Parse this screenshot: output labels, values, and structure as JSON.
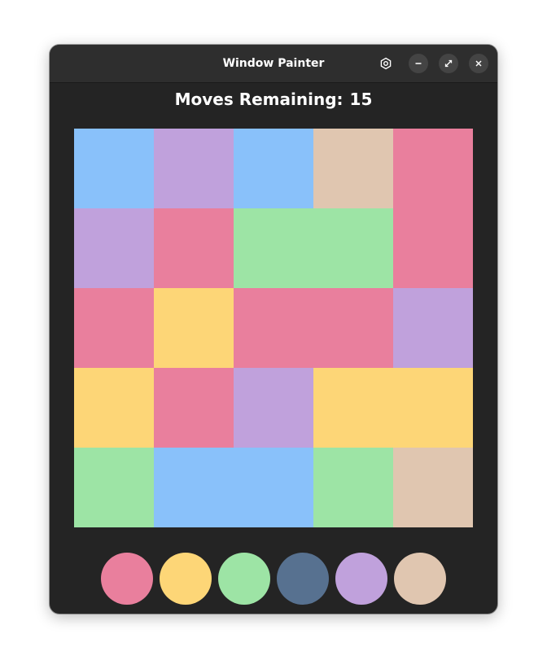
{
  "window": {
    "title": "Window Painter"
  },
  "titlebar": {
    "buttons": [
      {
        "name": "settings-icon"
      },
      {
        "name": "minimize-icon"
      },
      {
        "name": "maximize-icon"
      },
      {
        "name": "close-icon"
      }
    ]
  },
  "status": {
    "moves_label": "Moves Remaining:",
    "moves_value": "15"
  },
  "colors": {
    "window_bg": "#242424",
    "titlebar_bg": "#2e2e2e",
    "pink": "#e97f9d",
    "yellow": "#fdd677",
    "green": "#9de4a5",
    "navy": "#577190",
    "purple": "#c0a1dc",
    "tan": "#e0c6b0",
    "blue": "#89c1fa"
  },
  "board": {
    "rows": 5,
    "cols": 5,
    "cells": [
      [
        "blue",
        "purple",
        "blue",
        "tan",
        "pink"
      ],
      [
        "purple",
        "pink",
        "green",
        "green",
        "pink"
      ],
      [
        "pink",
        "yellow",
        "pink",
        "pink",
        "purple"
      ],
      [
        "yellow",
        "pink",
        "purple",
        "yellow",
        "yellow"
      ],
      [
        "green",
        "blue",
        "blue",
        "green",
        "tan"
      ]
    ]
  },
  "palette": [
    "pink",
    "yellow",
    "green",
    "navy",
    "purple",
    "tan"
  ]
}
